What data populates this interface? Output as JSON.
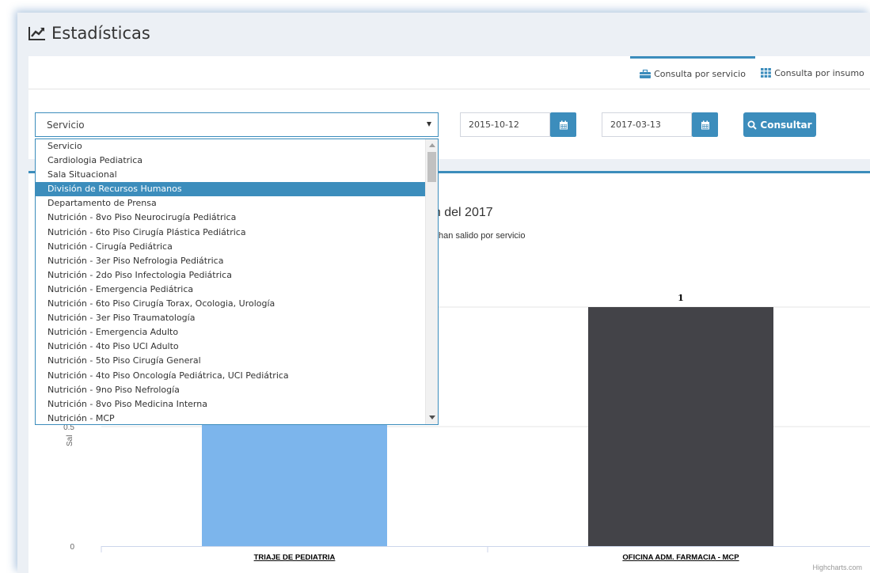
{
  "header": {
    "title": "Estadísticas"
  },
  "tabs": [
    {
      "label": "Consulta por servicio",
      "active": true
    },
    {
      "label": "Consulta por insumo",
      "active": false
    }
  ],
  "form": {
    "service_select_value": "Servicio",
    "date_from": "2015-10-12",
    "date_to": "2017-03-13",
    "consultar_label": "Consultar"
  },
  "dropdown": {
    "options": [
      "Servicio",
      "Cardiologia Pediatrica",
      "Sala Situacional",
      "División de Recursos Humanos",
      "Departamento de Prensa",
      "Nutrición - 8vo Piso Neurocirugía Pediátrica",
      "Nutrición - 6to Piso Cirugía Plástica Pediátrica",
      "Nutrición - Cirugía Pediátrica",
      "Nutrición - 3er Piso Nefrologia Pediátrica",
      "Nutrición - 2do Piso Infectologia Pediátrica",
      "Nutrición - Emergencia Pediátrica",
      "Nutrición - 6to Piso Cirugía Torax, Ocologia, Urología",
      "Nutrición - 3er Piso Traumatología",
      "Nutrición - Emergencia Adulto",
      "Nutrición - 4to Piso UCI Adulto",
      "Nutrición - 5to Piso Cirugía General",
      "Nutrición - 4to Piso Oncología Pediátrica, UCI Pediátrica",
      "Nutrición - 9no Piso Nefrología",
      "Nutrición - 8vo Piso Medicina Interna",
      "Nutrición - MCP"
    ],
    "selected_index": 3
  },
  "chart_data": {
    "type": "bar",
    "title_visible": "March del 2017",
    "subtitle_visible": "los insumos que han salido por servicio",
    "ylabel_visible": "Sal",
    "categories": [
      "TRIAJE DE PEDIATRIA",
      "OFICINA ADM. FARMACIA - MCP"
    ],
    "values": [
      1,
      1
    ],
    "data_labels": [
      "",
      "1"
    ],
    "colors": [
      "#7cb5ec",
      "#434348"
    ],
    "yticks": [
      "0",
      "0.5"
    ],
    "ylim": [
      0,
      1.5
    ],
    "grid": true,
    "credits": "Highcharts.com"
  },
  "colors": {
    "accent": "#3c8dbc",
    "background": "#ecf0f5"
  }
}
